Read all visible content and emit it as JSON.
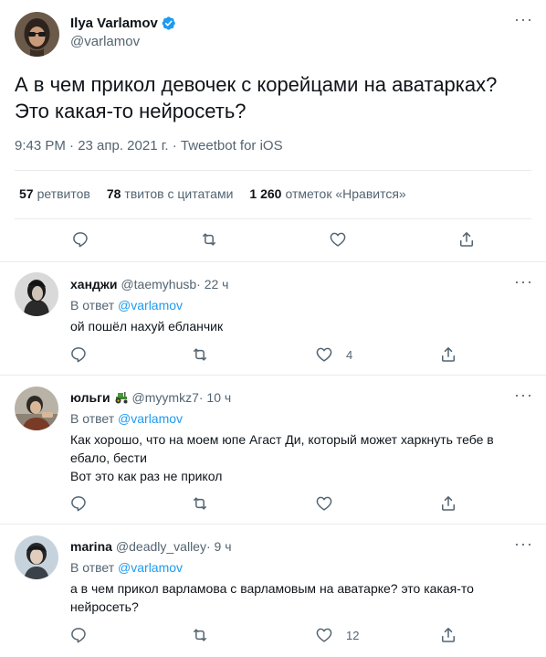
{
  "main_tweet": {
    "author_name": "Ilya Varlamov",
    "handle": "@varlamov",
    "text_line1": "А в чем прикол девочек с корейцами на аватарках?",
    "text_line2": "Это какая-то нейросеть?",
    "time": "9:43 PM · 23 апр. 2021 г. · ",
    "source": "Tweetbot for iOS",
    "retweets_count": "57",
    "retweets_label": "ретвитов",
    "quotes_count": "78",
    "quotes_label": "твитов с цитатами",
    "likes_count": "1 260",
    "likes_label": "отметок «Нравится»"
  },
  "replies": [
    {
      "name": "ханджи",
      "handle": "@taemyhusb",
      "time": " · 22 ч",
      "in_reply_prefix": "В ответ ",
      "in_reply_handle": "@varlamov",
      "text_lines": [
        "ой пошёл нахуй ебланчик"
      ],
      "like_count": "4"
    },
    {
      "name": "юльги",
      "handle": "@myymkz7",
      "time": " · 10 ч",
      "in_reply_prefix": "В ответ ",
      "in_reply_handle": "@varlamov",
      "text_lines": [
        "Как хорошо, что на моем юпе Агаст Ди, который может харкнуть тебе в",
        "ебало, бести",
        "Вот это как раз не прикол"
      ],
      "like_count": ""
    },
    {
      "name": "marina",
      "handle": "@deadly_valley",
      "time": " · 9 ч",
      "in_reply_prefix": "В ответ ",
      "in_reply_handle": "@varlamov",
      "text_lines": [
        "а в чем прикол варламова с варламовым на аватарке? это какая-то",
        "нейросеть?"
      ],
      "like_count": "12"
    }
  ],
  "more_label": "···",
  "colors": {
    "accent": "#1d9bf0",
    "text": "#0f1419",
    "secondary": "#536471",
    "divider": "#e8ecef"
  },
  "icons": [
    "verified-badge-icon",
    "reply-icon",
    "retweet-icon",
    "like-icon",
    "share-icon",
    "more-icon",
    "tractor-emoji"
  ]
}
